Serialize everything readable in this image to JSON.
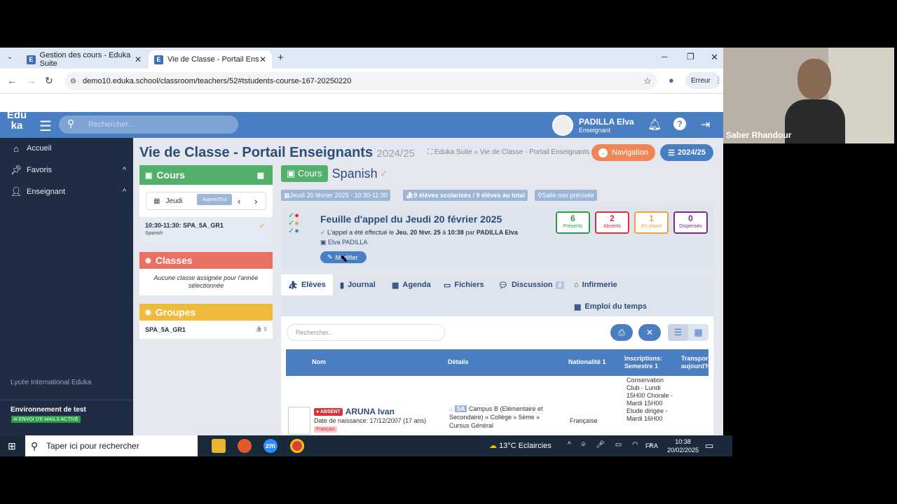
{
  "browser": {
    "tabs": [
      {
        "label": "Gestion des cours - Eduka Suite",
        "favicon": "E"
      },
      {
        "label": "Vie de Classe - Portail Enseigna",
        "favicon": "E"
      }
    ],
    "url": "demo10.eduka.school/classroom/teachers/52#tstudents-course-167-20250220",
    "error_label": "Erreur"
  },
  "app": {
    "logo": "Edu ka",
    "search_placeholder": "Rechercher...",
    "user": {
      "name": "PADILLA Elva",
      "role": "Enseignant"
    }
  },
  "sidebar": {
    "items": [
      {
        "label": "Accueil",
        "icon": "home-icon"
      },
      {
        "label": "Favoris",
        "icon": "pin-icon"
      },
      {
        "label": "Enseignant",
        "icon": "user-chalkboard-icon"
      }
    ],
    "school": "Lycée International Eduka",
    "env_label": "Environnement de test",
    "email_badge": "ENVOI D'E-MAILS ACTIVÉ"
  },
  "page": {
    "title": "Vie de Classe - Portail Enseignants",
    "year": "2024/25",
    "breadcrumb": "Eduka Suite » Vie de Classe - Portail Enseignants",
    "nav_button": "Navigation",
    "year_button": "2024/25"
  },
  "cours_panel": {
    "title": "Cours",
    "day": "Jeudi",
    "today_button": "Aujourd'hui",
    "slot_time": "10:30-11:30: SPA_5A_GR1",
    "slot_subject": "Spanish"
  },
  "classes_panel": {
    "title": "Classes",
    "message": "Aucune classe assignée pour l'année sélectionnée"
  },
  "groupes_panel": {
    "title": "Groupes",
    "group_name": "SPA_5A_GR1",
    "count": "9"
  },
  "course": {
    "button": "Cours",
    "name": "Spanish",
    "date_badge": "Jeudi 20 février 2025 · 10:30-11:30",
    "students_badge": "9 élèves scolarisés / 9 élèves au total",
    "room_badge": "Salle non précisée"
  },
  "attendance": {
    "title": "Feuille d'appel du Jeudi 20 février 2025",
    "detail_prefix": "L'appel a été effectué le",
    "detail_date": "Jeu. 20 févr. 25",
    "detail_at": "à",
    "detail_time": "10:38",
    "detail_by": "par",
    "detail_teacher": "PADILLA Elva",
    "teacher": "Elva PADILLA",
    "edit_button": "Modifier",
    "stats": [
      {
        "value": "6",
        "label": "Présents",
        "color": "#2e9b4b"
      },
      {
        "value": "2",
        "label": "Absents",
        "color": "#d9303a"
      },
      {
        "value": "1",
        "label": "En retard",
        "color": "#f0a23a"
      },
      {
        "value": "0",
        "label": "Dispensés",
        "color": "#7a2a8a"
      }
    ]
  },
  "tabs": [
    {
      "label": "Elèves"
    },
    {
      "label": "Journal"
    },
    {
      "label": "Agenda"
    },
    {
      "label": "Fichiers"
    },
    {
      "label": "Discussion",
      "badge": "0"
    },
    {
      "label": "Infirmerie"
    },
    {
      "label": "Emploi du temps"
    }
  ],
  "students": {
    "search_placeholder": "Rechercher...",
    "columns": [
      "Nom",
      "Détails",
      "Nationalité 1",
      "Inscriptions: Semestre 1",
      "Transport aujourd'h"
    ],
    "rows": [
      {
        "status": "ABSENT",
        "name": "ARUNA Ivan",
        "birth": "Date de naissance: 17/12/2007 (17 ans)",
        "language": "Français",
        "class_code": "5A",
        "details": "Campus B (Elémentaire et Secondaire) » Collège » 5ème » Cursus Général",
        "nationality": "Française",
        "inscriptions": "Conservation Club - Lundi 15H00 Chorale - Mardi 15H00 Etude dirigée - Mardi 16H00"
      }
    ]
  },
  "video": {
    "participant": "Saber Rhandour"
  },
  "taskbar": {
    "search_placeholder": "Taper ici pour rechercher",
    "weather": "13°C Eclaircies",
    "lang": "FRA",
    "time": "10:38",
    "date": "20/02/2025"
  }
}
